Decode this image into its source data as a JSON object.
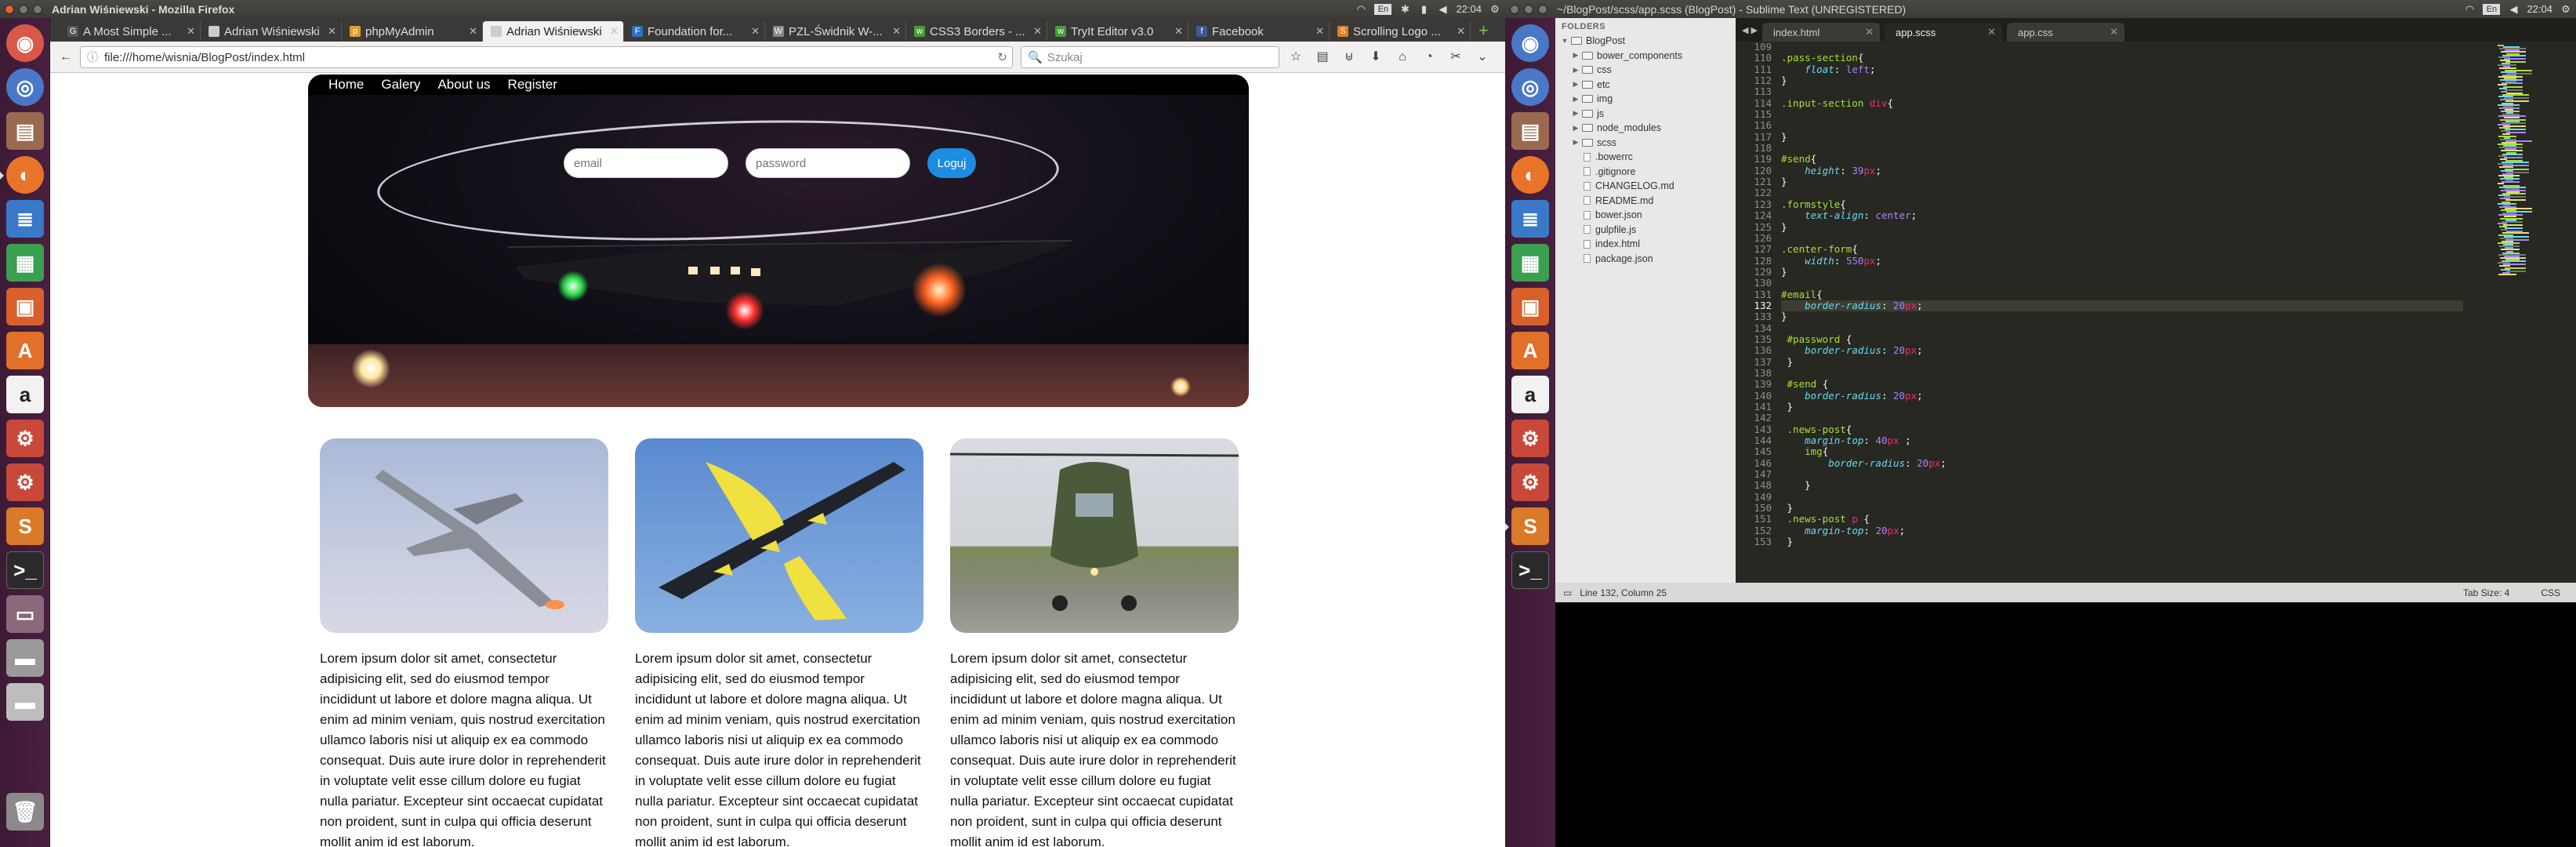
{
  "left": {
    "window_title": "Adrian Wiśniewski - Mozilla Firefox",
    "clock": "22:04",
    "kbd": "En",
    "tabs": [
      {
        "label": "A Most Simple ...",
        "fav": "G",
        "color": "#555"
      },
      {
        "label": "Adrian Wiśniewski",
        "fav": "",
        "color": "#ccc"
      },
      {
        "label": "phpMyAdmin",
        "fav": "p",
        "color": "#e59b2b"
      },
      {
        "label": "Adrian Wiśniewski",
        "fav": "",
        "color": "#ccc"
      },
      {
        "label": "Foundation for...",
        "fav": "F",
        "color": "#2a70c8"
      },
      {
        "label": "PZL-Świdnik W-...",
        "fav": "W",
        "color": "#888"
      },
      {
        "label": "CSS3 Borders - ...",
        "fav": "w",
        "color": "#4a9a3a"
      },
      {
        "label": "TryIt Editor v3.0",
        "fav": "w",
        "color": "#4a9a3a"
      },
      {
        "label": "Facebook",
        "fav": "f",
        "color": "#3b5998"
      },
      {
        "label": "Scrolling Logo ...",
        "fav": "S",
        "color": "#e08020"
      }
    ],
    "selected_tab": 3,
    "url": "file:///home/wisnia/BlogPost/index.html",
    "search_placeholder": "Szukaj",
    "page": {
      "nav": [
        "Home",
        "Galery",
        "About us",
        "Register"
      ],
      "email_placeholder": "email",
      "password_placeholder": "password",
      "login_label": "Loguj",
      "posts": [
        {
          "text": "Lorem ipsum dolor sit amet, consectetur adipisicing elit, sed do eiusmod tempor incididunt ut labore et dolore magna aliqua. Ut enim ad minim veniam, quis nostrud exercitation ullamco laboris nisi ut aliquip ex ea commodo consequat. Duis aute irure dolor in reprehenderit in voluptate velit esse cillum dolore eu fugiat nulla pariatur. Excepteur sint occaecat cupidatat non proident, sunt in culpa qui officia deserunt mollit anim id est laborum."
        },
        {
          "text": "Lorem ipsum dolor sit amet, consectetur adipisicing elit, sed do eiusmod tempor incididunt ut labore et dolore magna aliqua. Ut enim ad minim veniam, quis nostrud exercitation ullamco laboris nisi ut aliquip ex ea commodo consequat. Duis aute irure dolor in reprehenderit in voluptate velit esse cillum dolore eu fugiat nulla pariatur. Excepteur sint occaecat cupidatat non proident, sunt in culpa qui officia deserunt mollit anim id est laborum."
        },
        {
          "text": "Lorem ipsum dolor sit amet, consectetur adipisicing elit, sed do eiusmod tempor incididunt ut labore et dolore magna aliqua. Ut enim ad minim veniam, quis nostrud exercitation ullamco laboris nisi ut aliquip ex ea commodo consequat. Duis aute irure dolor in reprehenderit in voluptate velit esse cillum dolore eu fugiat nulla pariatur. Excepteur sint occaecat cupidatat non proident, sunt in culpa qui officia deserunt mollit anim id est laborum."
        }
      ]
    }
  },
  "right": {
    "window_title": "~/BlogPost/scss/app.scss (BlogPost) - Sublime Text (UNREGISTERED)",
    "clock": "22:04",
    "kbd": "En",
    "folders_header": "FOLDERS",
    "tree": [
      {
        "name": "BlogPost",
        "type": "folder",
        "depth": 0,
        "open": true
      },
      {
        "name": "bower_components",
        "type": "folder",
        "depth": 1
      },
      {
        "name": "css",
        "type": "folder",
        "depth": 1
      },
      {
        "name": "etc",
        "type": "folder",
        "depth": 1
      },
      {
        "name": "img",
        "type": "folder",
        "depth": 1
      },
      {
        "name": "js",
        "type": "folder",
        "depth": 1
      },
      {
        "name": "node_modules",
        "type": "folder",
        "depth": 1
      },
      {
        "name": "scss",
        "type": "folder",
        "depth": 1
      },
      {
        "name": ".bowerrc",
        "type": "file",
        "depth": 1
      },
      {
        "name": ".gitignore",
        "type": "file",
        "depth": 1
      },
      {
        "name": "CHANGELOG.md",
        "type": "file",
        "depth": 1
      },
      {
        "name": "README.md",
        "type": "file",
        "depth": 1
      },
      {
        "name": "bower.json",
        "type": "file",
        "depth": 1
      },
      {
        "name": "gulpfile.js",
        "type": "file",
        "depth": 1
      },
      {
        "name": "index.html",
        "type": "file",
        "depth": 1
      },
      {
        "name": "package.json",
        "type": "file",
        "depth": 1
      }
    ],
    "tabs": [
      "index.html",
      "app.scss",
      "app.css"
    ],
    "selected_tab": 1,
    "first_line": 109,
    "current_line": 132,
    "code": [
      "",
      ".pass-section{",
      "    float: left;",
      "}",
      "",
      ".input-section div{",
      "",
      "",
      "}",
      "",
      "#send{",
      "    height: 39px;",
      "}",
      "",
      ".formstyle{",
      "    text-align: center;",
      "}",
      "",
      ".center-form{",
      "    width: 550px;",
      "}",
      "",
      "#email{",
      "    border-radius: 20px;",
      "}",
      "",
      " #password {",
      "    border-radius: 20px;",
      " }",
      "",
      " #send {",
      "    border-radius: 20px;",
      " }",
      "",
      " .news-post{",
      "    margin-top: 40px ;",
      "    img{",
      "        border-radius: 20px;",
      "",
      "    }",
      "",
      " }",
      " .news-post p {",
      "    margin-top: 20px;",
      " }"
    ],
    "status_left": "Line 132, Column 25",
    "status_tab": "Tab Size: 4",
    "status_syntax": "CSS"
  }
}
